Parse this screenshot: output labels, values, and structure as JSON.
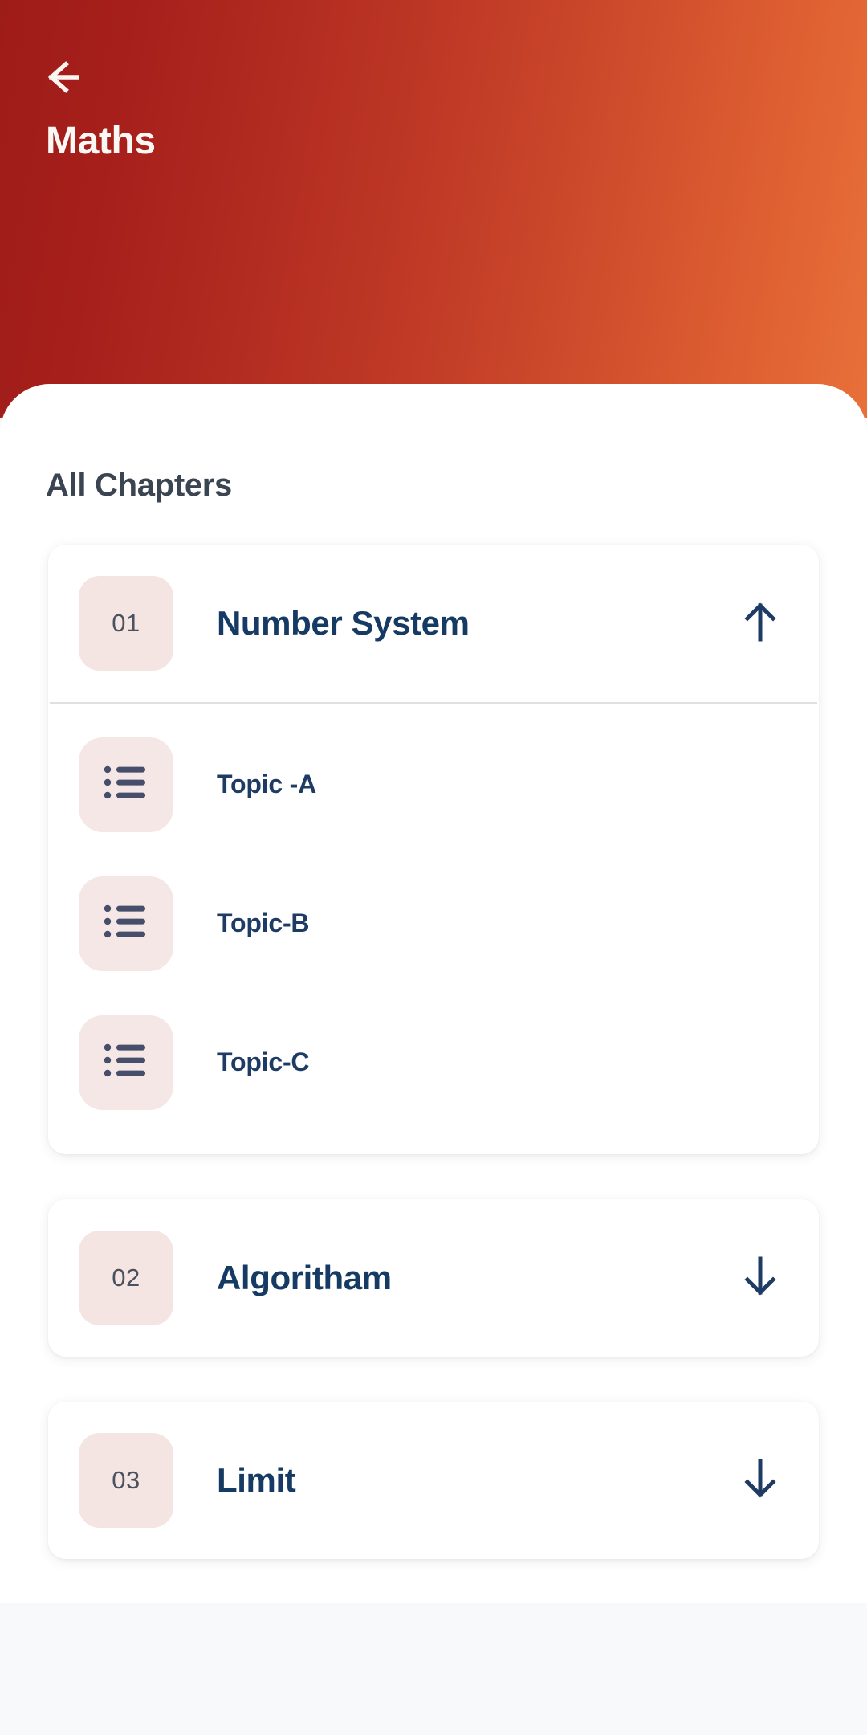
{
  "header": {
    "back_icon": "arrow-left-icon",
    "title": "Maths",
    "gradient_from": "#9e1c18",
    "gradient_to": "#e8703a"
  },
  "main": {
    "section_title": "All Chapters",
    "accent_navy": "#153a63",
    "badge_bg": "#f4e4e2",
    "chapters": [
      {
        "number": "01",
        "name": "Number System",
        "expanded": true,
        "toggle_icon": "arrow-up-icon",
        "topics": [
          {
            "icon": "list-icon",
            "label": "Topic -A"
          },
          {
            "icon": "list-icon",
            "label": "Topic-B"
          },
          {
            "icon": "list-icon",
            "label": "Topic-C"
          }
        ]
      },
      {
        "number": "02",
        "name": "Algoritham",
        "expanded": false,
        "toggle_icon": "arrow-down-icon",
        "topics": []
      },
      {
        "number": "03",
        "name": "Limit",
        "expanded": false,
        "toggle_icon": "arrow-down-icon",
        "topics": []
      }
    ]
  }
}
